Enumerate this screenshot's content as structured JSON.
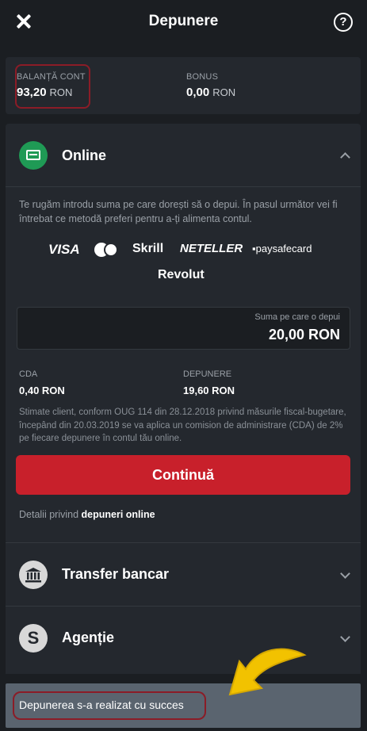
{
  "header": {
    "title": "Depunere",
    "close_icon": "close-icon",
    "help_icon": "help-icon",
    "help_symbol": "?"
  },
  "balance": {
    "account_label": "BALANȚĂ CONT",
    "account_value": "93,20",
    "account_currency": "RON",
    "bonus_label": "BONUS",
    "bonus_value": "0,00",
    "bonus_currency": "RON"
  },
  "online": {
    "label": "Online",
    "icon": "card-icon",
    "intro": "Te rugăm introdu suma pe care dorești să o depui. În pasul următor vei fi întrebat ce metodă preferi pentru a-ți alimenta contul.",
    "logos": [
      "VISA",
      "mastercard",
      "Skrill",
      "NETELLER",
      "paysafecard",
      "Revolut"
    ],
    "amount_label": "Suma pe care o depui",
    "amount_value": "20,00 RON",
    "cda_label": "CDA",
    "cda_value": "0,40 RON",
    "deposit_label": "DEPUNERE",
    "deposit_value": "19,60 RON",
    "notice": "Stimate client, conform OUG 114 din 28.12.2018 privind măsurile fiscal-bugetare, începând din 20.03.2019 se va aplica un comision de administrare (CDA) de 2% pe fiecare depunere în contul tău online.",
    "continue_label": "Continuă",
    "details_prefix": "Detalii privind",
    "details_link": "depuneri online"
  },
  "sections": [
    {
      "label": "Transfer bancar",
      "icon": "bank-icon"
    },
    {
      "label": "Agenție",
      "icon": "agency-icon"
    }
  ],
  "toast": {
    "message": "Depunerea s-a realizat cu succes"
  },
  "colors": {
    "accent": "#c8202b",
    "online_icon": "#1f9a55",
    "highlight": "#8b1c27",
    "annotation_arrow": "#f2c200"
  }
}
